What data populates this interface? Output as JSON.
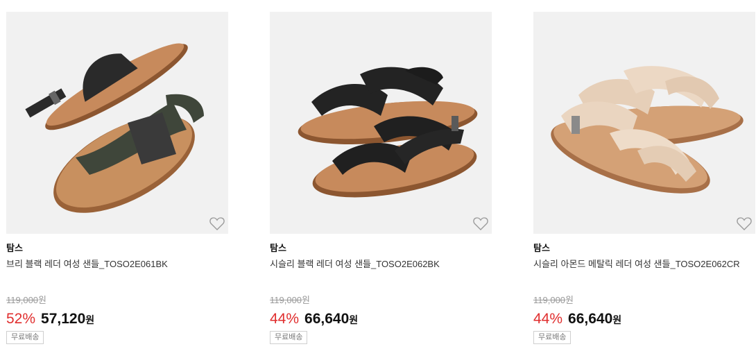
{
  "products": [
    {
      "brand": "탐스",
      "name": "브리 블랙 레더 여성 샌들_TOSO2E061BK",
      "original_price": "119,000",
      "original_unit": "원",
      "discount": "52%",
      "price": "57,120",
      "price_unit": "원",
      "shipping_badge": "무료배송",
      "image_icon": "sandal-thong-black-image"
    },
    {
      "brand": "탐스",
      "name": "시슬리 블랙 레더 여성 샌들_TOSO2E062BK",
      "original_price": "119,000",
      "original_unit": "원",
      "discount": "44%",
      "price": "66,640",
      "price_unit": "원",
      "shipping_badge": "무료배송",
      "image_icon": "sandal-strappy-black-image"
    },
    {
      "brand": "탐스",
      "name": "시슬리 아몬드 메탈릭 레더 여성 샌들_TOSO2E062CR",
      "original_price": "119,000",
      "original_unit": "원",
      "discount": "44%",
      "price": "66,640",
      "price_unit": "원",
      "shipping_badge": "무료배송",
      "image_icon": "sandal-strappy-almond-image"
    }
  ],
  "colors": {
    "discount": "#e02e2e",
    "sole": "#b5774a",
    "black_strap": "#2a2a2a",
    "olive_strap": "#3f463a",
    "almond_strap": "#e8d2bd",
    "thumb_bg": "#f1f1f1"
  },
  "icons": {
    "wishlist": "heart-outline-icon"
  }
}
